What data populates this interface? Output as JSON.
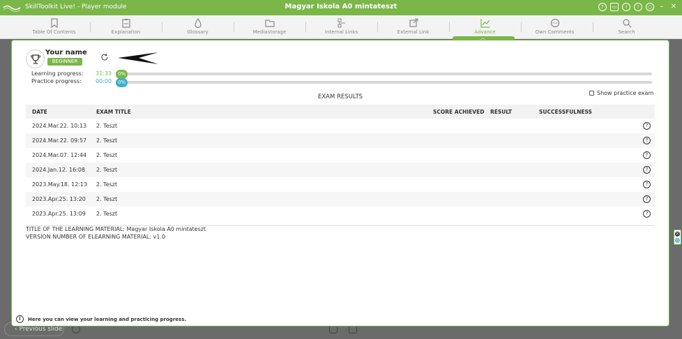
{
  "titlebar": {
    "app_title": "SkillToolkit Live! - Player module",
    "doc_title": "Magyar Iskola A0 mintateszt"
  },
  "toolbar": {
    "items": [
      {
        "label": "Table Of Contents",
        "icon": "bookmark-icon"
      },
      {
        "label": "Explanation",
        "icon": "clipboard-icon"
      },
      {
        "label": "Glossary",
        "icon": "drop-icon"
      },
      {
        "label": "Mediastorage",
        "icon": "folder-icon"
      },
      {
        "label": "Internal Links",
        "icon": "link-flow-icon"
      },
      {
        "label": "External Link",
        "icon": "external-link-icon"
      },
      {
        "label": "Advance",
        "icon": "chart-icon"
      },
      {
        "label": "Own Comments",
        "icon": "comment-icon"
      },
      {
        "label": "Search",
        "icon": "search-icon"
      }
    ],
    "active_index": 6
  },
  "user": {
    "name": "Your name",
    "level": "BEGINNER"
  },
  "progress": {
    "learning": {
      "label": "Learning progress:",
      "time": "31:33",
      "percent_text": "0%",
      "percent": 0
    },
    "practice": {
      "label": "Practice progress:",
      "time": "00:00",
      "percent_text": "0%",
      "percent": 0
    }
  },
  "exam": {
    "title": "EXAM RESULTS",
    "show_practice_label": "Show practice exam",
    "show_practice_checked": false,
    "headers": {
      "date": "DATE",
      "exam_title": "EXAM TITLE",
      "score": "SCORE ACHIEVED",
      "result": "RESULT",
      "successfulness": "SUCCESSFULNESS"
    },
    "rows": [
      {
        "date": "2024.Mar.22. 10:13",
        "exam_title": "2. Teszt",
        "score": "",
        "result": "",
        "successfulness": ""
      },
      {
        "date": "2024.Mar.22. 09:57",
        "exam_title": "2. Teszt",
        "score": "",
        "result": "",
        "successfulness": ""
      },
      {
        "date": "2024.Mar.07. 12:44",
        "exam_title": "2. Teszt",
        "score": "",
        "result": "",
        "successfulness": ""
      },
      {
        "date": "2024.Jan.12. 16:08",
        "exam_title": "2. Teszt",
        "score": "",
        "result": "",
        "successfulness": ""
      },
      {
        "date": "2023.May.18. 12:13",
        "exam_title": "2. Teszt",
        "score": "",
        "result": "",
        "successfulness": ""
      },
      {
        "date": "2023.Apr.25. 13:20",
        "exam_title": "2. Teszt",
        "score": "",
        "result": "",
        "successfulness": ""
      },
      {
        "date": "2023.Apr.25. 13:09",
        "exam_title": "2. Teszt",
        "score": "",
        "result": "",
        "successfulness": ""
      }
    ]
  },
  "meta": {
    "material_title": "TITLE OF THE LEARNING MATERIAL: Magyar Iskola A0 mintateszt",
    "version": "VERSION NUMBER OF ELEARNING MATERIAL: v1.0"
  },
  "footer": {
    "note": "Here you can view your learning and practicing progress."
  },
  "navigation": {
    "prev_label": "Previous slide"
  },
  "colors": {
    "accent": "#7ab648",
    "practice": "#3ab0c8"
  }
}
